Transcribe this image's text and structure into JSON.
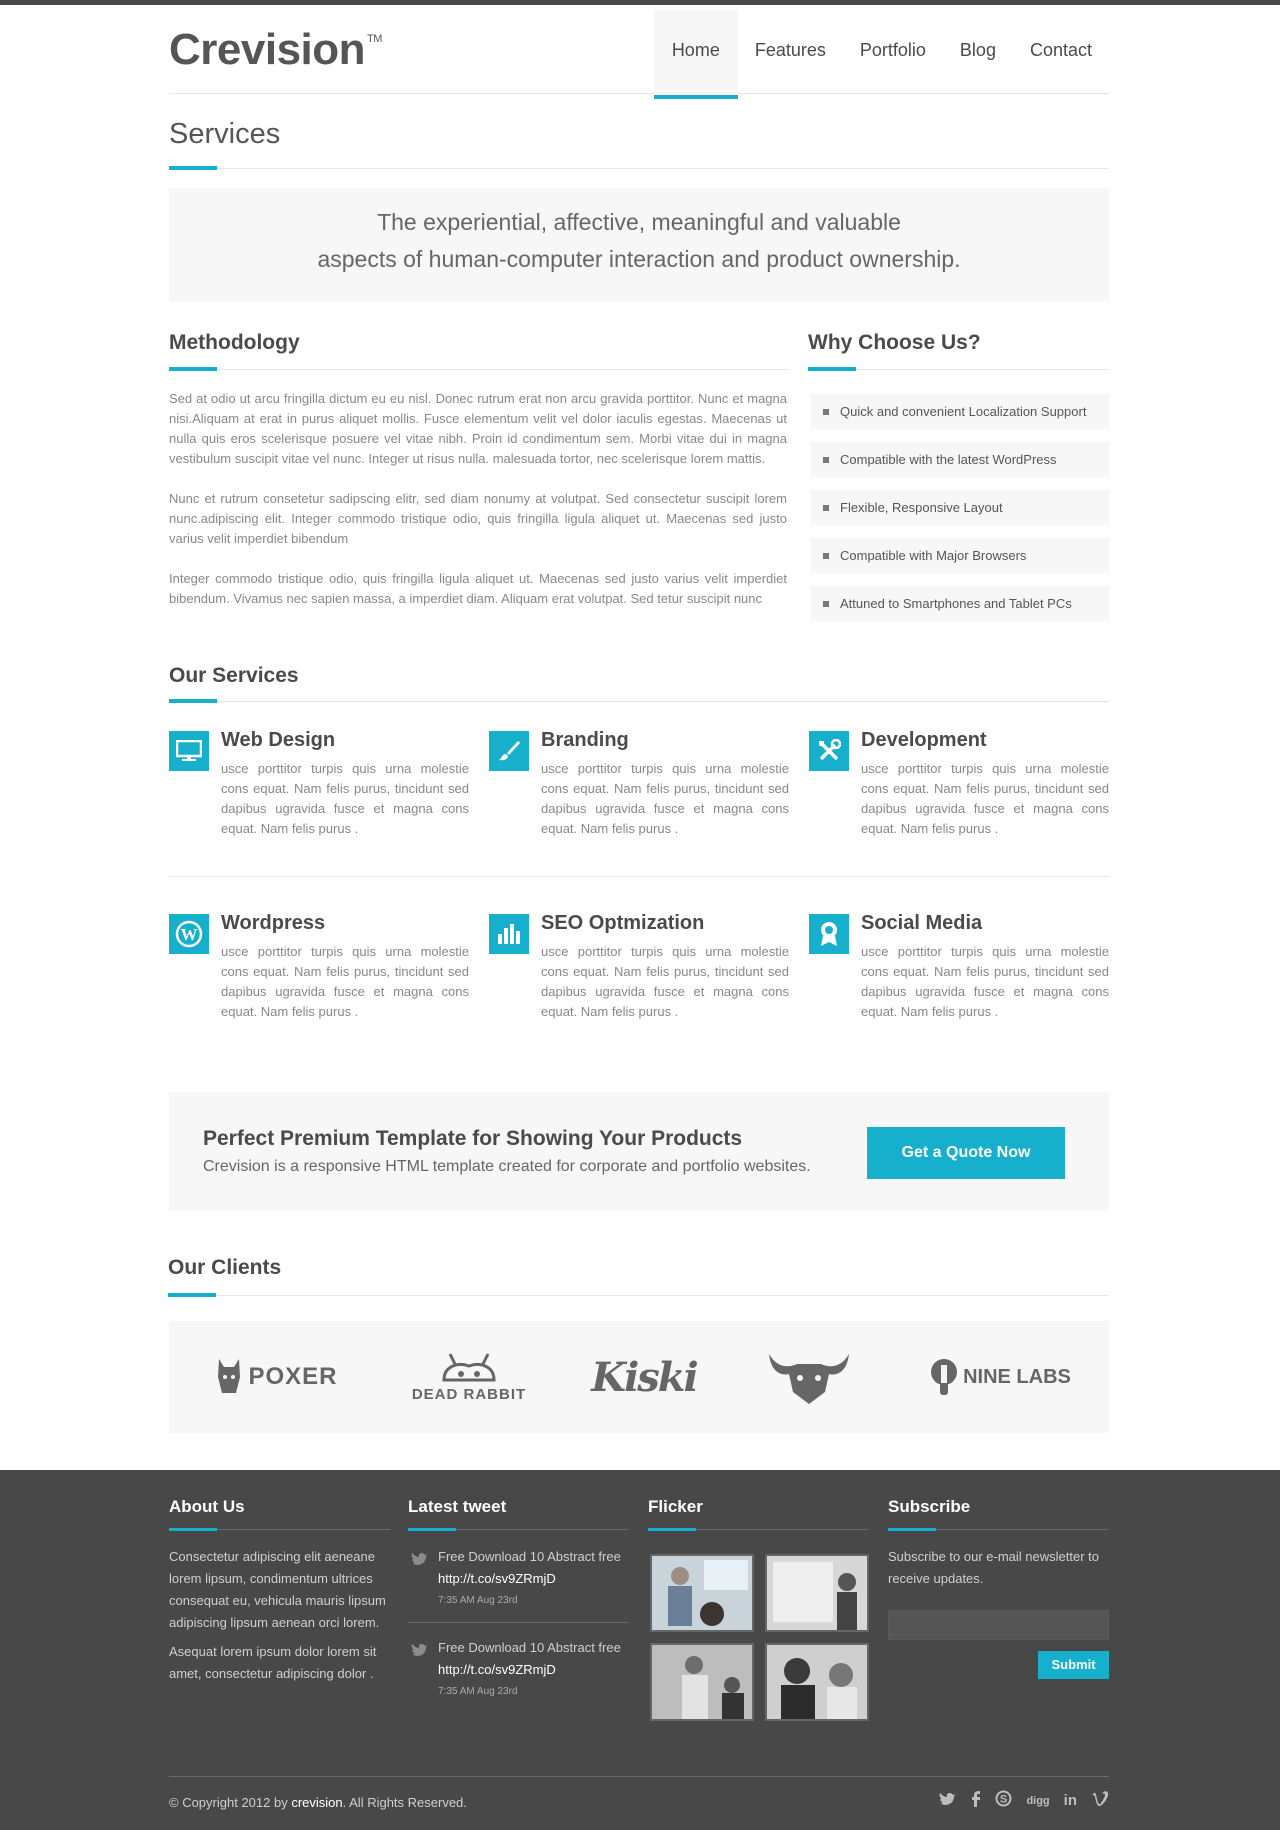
{
  "brand": {
    "logo": "Crevision",
    "trademark": "TM"
  },
  "nav": [
    {
      "label": "Home",
      "active": true
    },
    {
      "label": "Features",
      "active": false
    },
    {
      "label": "Portfolio",
      "active": false
    },
    {
      "label": "Blog",
      "active": false
    },
    {
      "label": "Contact",
      "active": false
    }
  ],
  "page_title": "Services",
  "intro": {
    "line1": "The experiential, affective, meaningful and valuable",
    "line2": "aspects of human-computer interaction and product ownership."
  },
  "methodology": {
    "title": "Methodology",
    "paragraphs": [
      "Sed at odio ut arcu fringilla dictum eu eu nisl. Donec rutrum erat non arcu gravida porttitor. Nunc et magna nisi.Aliquam at erat in purus aliquet mollis. Fusce elementum velit vel dolor iaculis egestas. Maecenas ut nulla quis eros scelerisque posuere vel vitae nibh. Proin id condimentum sem. Morbi vitae dui in magna vestibulum suscipit vitae vel nunc. Integer ut risus nulla. malesuada tortor, nec scelerisque lorem mattis.",
      "Nunc et rutrum consetetur sadipscing elitr, sed diam nonumy at volutpat. Sed consectetur suscipit lorem nunc.adipiscing elit. Integer commodo tristique odio, quis fringilla ligula aliquet ut. Maecenas sed justo varius velit imperdiet bibendum",
      "Integer commodo tristique odio, quis fringilla ligula aliquet ut. Maecenas sed justo varius velit imperdiet bibendum. Vivamus nec sapien massa, a imperdiet diam. Aliquam erat volutpat. Sed tetur suscipit nunc"
    ]
  },
  "why": {
    "title": "Why Choose Us?",
    "items": [
      "Quick and convenient Localization Support",
      "Compatible with the latest WordPress",
      "Flexible, Responsive Layout",
      "Compatible with Major Browsers",
      "Attuned to Smartphones and Tablet PCs"
    ]
  },
  "services": {
    "title": "Our Services",
    "items": [
      {
        "name": "Web Design",
        "icon": "monitor-icon",
        "desc": "usce porttitor turpis quis urna molestie cons equat. Nam felis purus, tincidunt sed dapibus ugravida fusce et magna cons equat. Nam felis purus ."
      },
      {
        "name": "Branding",
        "icon": "brush-icon",
        "desc": "usce porttitor turpis quis urna molestie cons equat. Nam felis purus, tincidunt sed dapibus ugravida fusce et magna cons equat. Nam felis purus ."
      },
      {
        "name": "Development",
        "icon": "tools-icon",
        "desc": "usce porttitor turpis quis urna molestie cons equat. Nam felis purus, tincidunt sed dapibus ugravida fusce et magna cons equat. Nam felis purus ."
      },
      {
        "name": "Wordpress",
        "icon": "wordpress-icon",
        "desc": "usce porttitor turpis quis urna molestie cons equat. Nam felis purus, tincidunt sed dapibus ugravida fusce et magna cons equat. Nam felis purus ."
      },
      {
        "name": "SEO Optmization",
        "icon": "bar-chart-icon",
        "desc": "usce porttitor turpis quis urna molestie cons equat. Nam felis purus, tincidunt sed dapibus ugravida fusce et magna cons equat. Nam felis purus ."
      },
      {
        "name": "Social Media",
        "icon": "badge-icon",
        "desc": "usce porttitor turpis quis urna molestie cons equat. Nam felis purus, tincidunt sed dapibus ugravida fusce et magna cons equat. Nam felis purus ."
      }
    ]
  },
  "cta": {
    "heading": "Perfect Premium Template for Showing Your Products",
    "subtext": "Crevision is a responsive HTML template created for corporate and portfolio websites.",
    "button": "Get a Quote Now"
  },
  "clients": {
    "title": "Our Clients",
    "logos": [
      "POXER",
      "DEAD RABBIT",
      "Kiski",
      "NINE LABS"
    ]
  },
  "footer": {
    "about": {
      "title": "About Us",
      "p1": "Consectetur adipiscing elit aeneane lorem lipsum, condimentum ultrices consequat eu, vehicula mauris lipsum adipiscing lipsum aenean orci lorem.",
      "p2": "Asequat lorem ipsum dolor lorem sit amet, consectetur adipiscing dolor ."
    },
    "tweets": {
      "title": "Latest tweet",
      "items": [
        {
          "text": "Free Download 10 Abstract free",
          "link": "http://t.co/sv9ZRmjD",
          "time": "7:35 AM Aug 23rd"
        },
        {
          "text": "Free Download 10 Abstract free",
          "link": "http://t.co/sv9ZRmjD",
          "time": "7:35 AM Aug 23rd"
        }
      ]
    },
    "flicker": {
      "title": "Flicker"
    },
    "subscribe": {
      "title": "Subscribe",
      "text": "Subscribe to our e-mail newsletter to receive updates.",
      "input_placeholder": "",
      "button": "Submit"
    },
    "copyright_prefix": "© Copyright 2012 by ",
    "copyright_brand": "crevision",
    "copyright_suffix": ". All Rights Reserved.",
    "social": [
      "twitter-icon",
      "facebook-icon",
      "skype-icon",
      "digg-icon",
      "linkedin-icon",
      "vimeo-icon"
    ],
    "social_labels": {
      "digg": "digg",
      "linkedin": "in"
    }
  },
  "colors": {
    "accent": "#17b0cc",
    "footer_bg": "#484848",
    "text_dark": "#4a4a4a"
  }
}
